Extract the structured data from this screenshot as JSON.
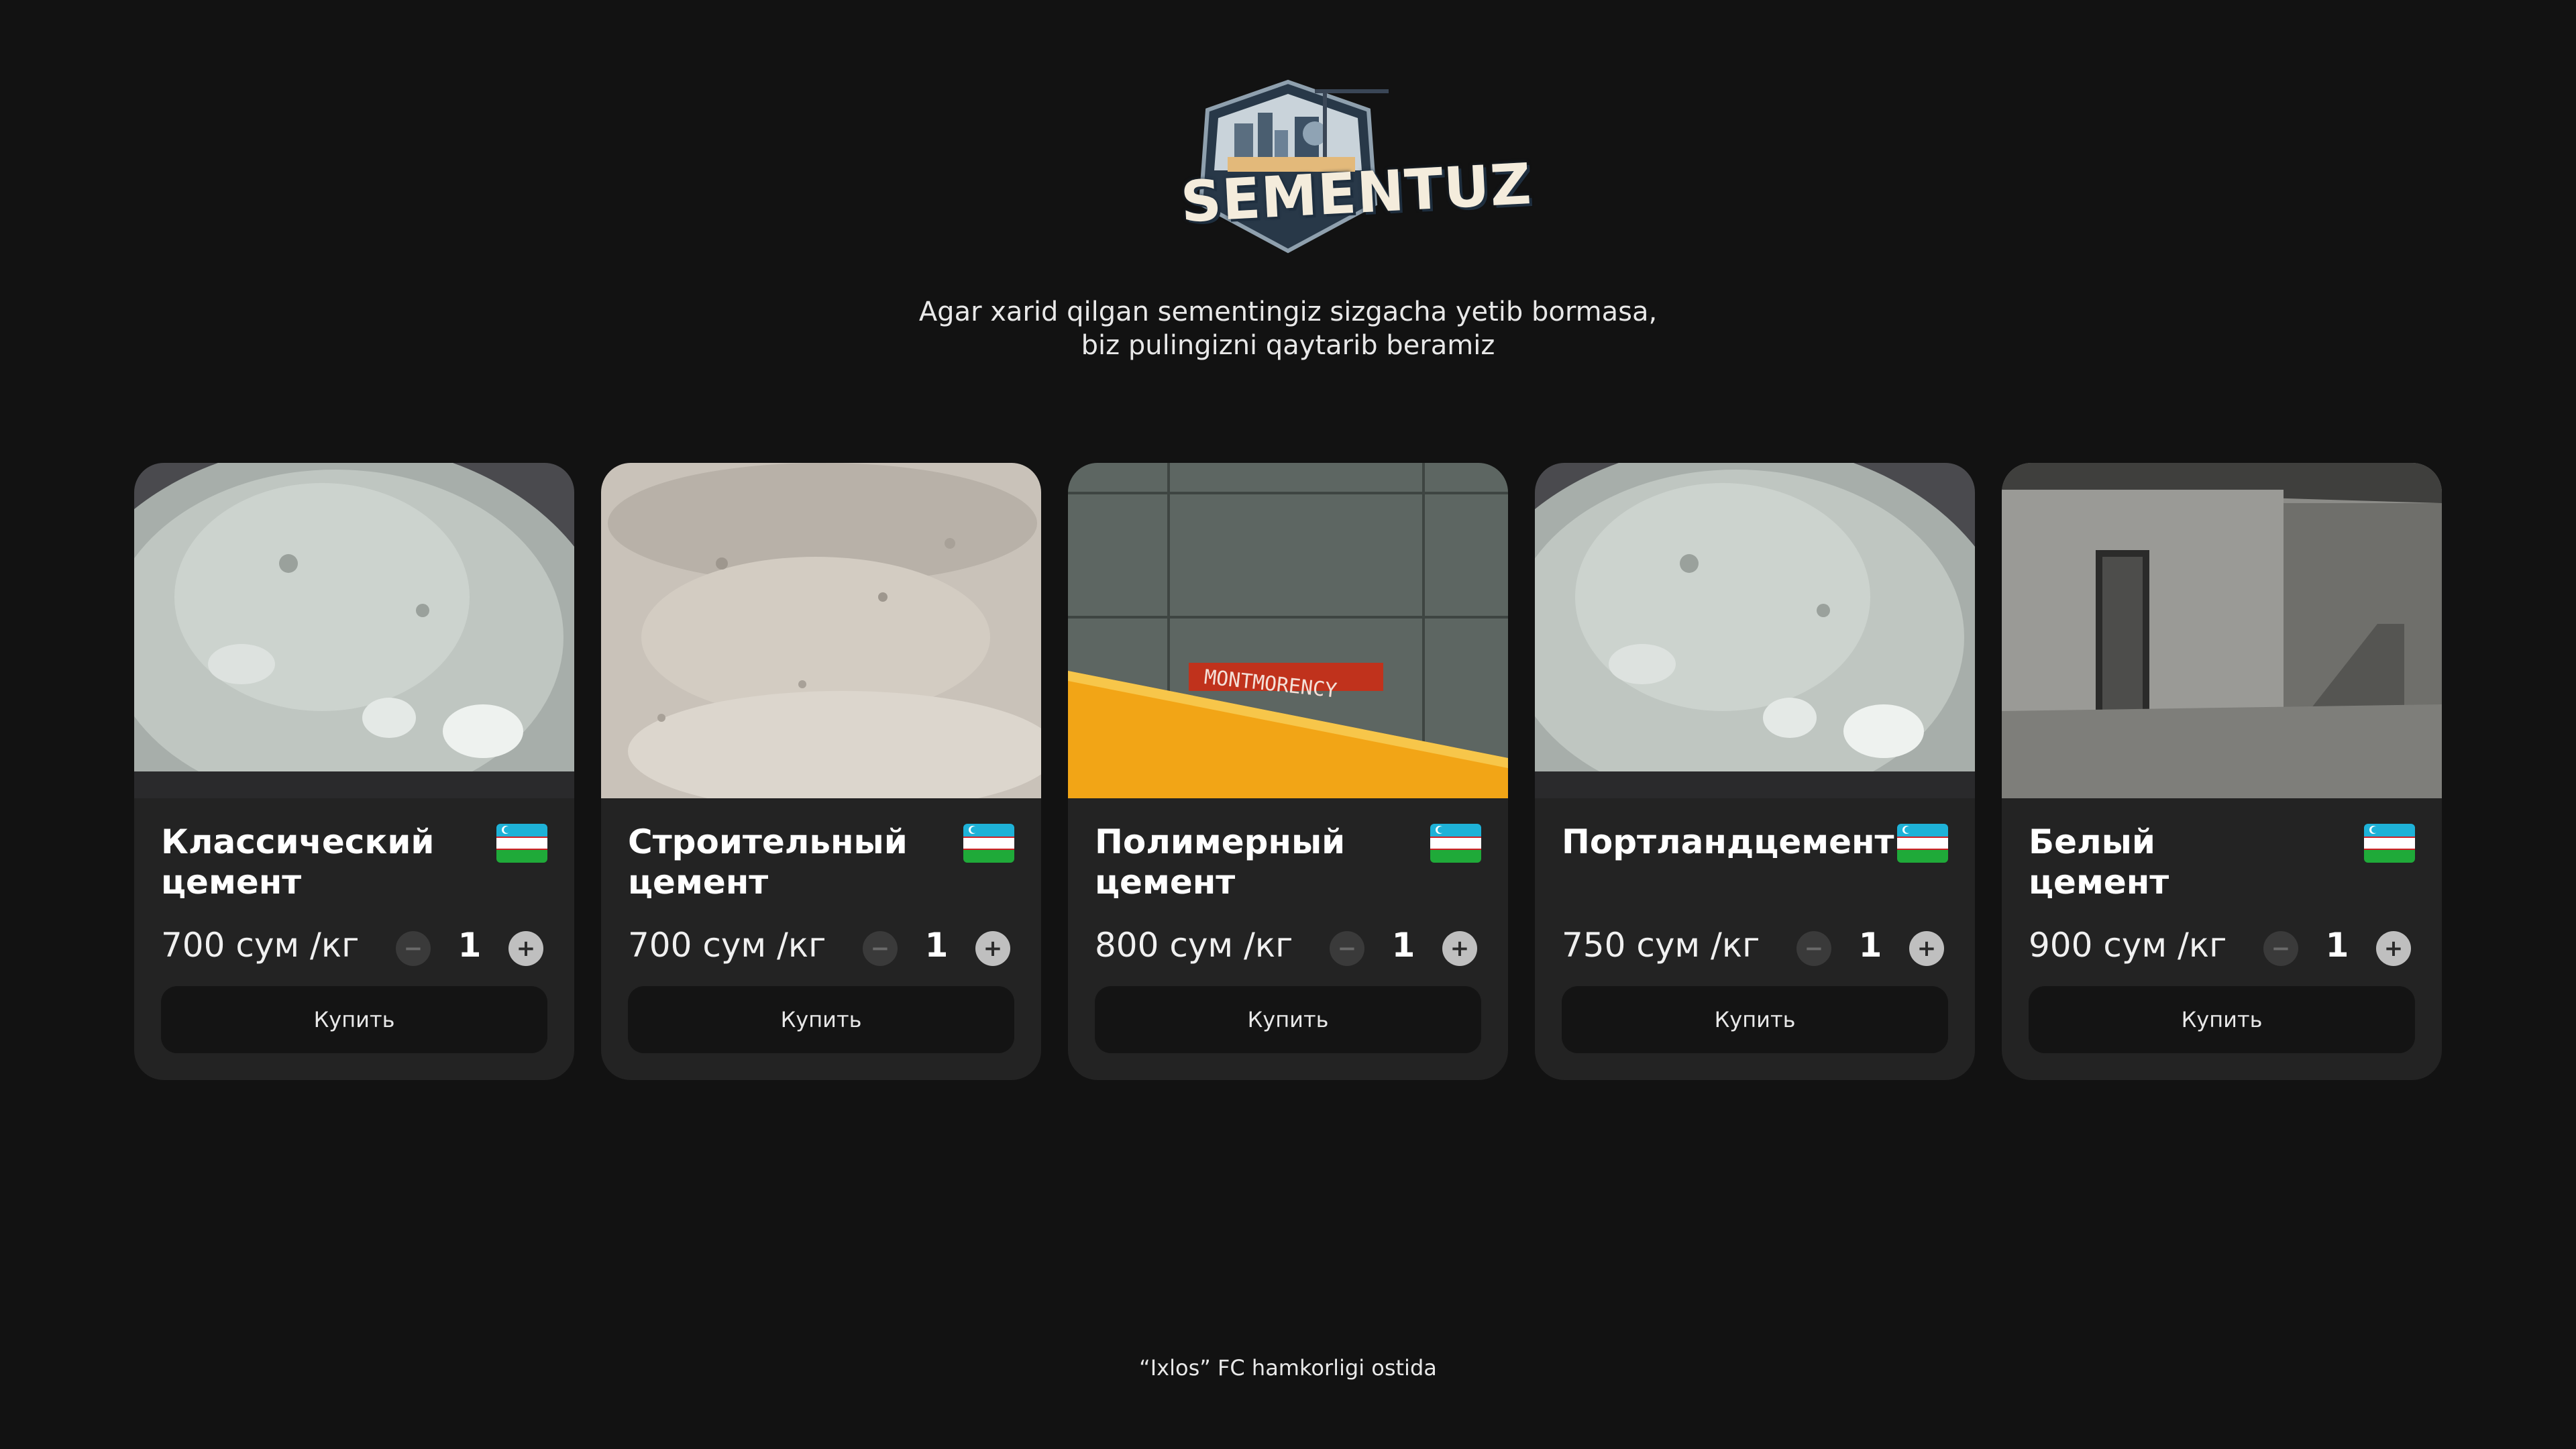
{
  "brand": {
    "name": "SEMENTUZ",
    "accent": "#5a7a90"
  },
  "tagline": {
    "line1": "Agar xarid qilgan sementingiz sizgacha yetib bormasa,",
    "line2": "biz pulingizni qaytarib beramiz"
  },
  "products": [
    {
      "title_line1": "Классический",
      "title_line2": "цемент",
      "price": "700 сум /кг",
      "qty": "1",
      "buy": "Купить",
      "image": "cement-powder-photo",
      "flag": "uzbekistan-flag-icon"
    },
    {
      "title_line1": "Строительный",
      "title_line2": "цемент",
      "price": "700 сум /кг",
      "qty": "1",
      "buy": "Купить",
      "image": "sandy-cement-photo",
      "flag": "uzbekistan-flag-icon"
    },
    {
      "title_line1": "Полимерный",
      "title_line2": "цемент",
      "price": "800 сум /кг",
      "qty": "1",
      "buy": "Купить",
      "image": "concrete-wall-photo",
      "sign_text": "MONTMORENCY",
      "flag": "uzbekistan-flag-icon"
    },
    {
      "title_line1": "Портландцемент",
      "title_line2": "",
      "price": "750 сум /кг",
      "qty": "1",
      "buy": "Купить",
      "image": "cement-powder-photo",
      "flag": "uzbekistan-flag-icon"
    },
    {
      "title_line1": "Белый",
      "title_line2": "цемент",
      "price": "900 сум /кг",
      "qty": "1",
      "buy": "Купить",
      "image": "concrete-interior-photo",
      "flag": "uzbekistan-flag-icon"
    }
  ],
  "controls": {
    "minus_symbol": "−",
    "plus_symbol": "+"
  },
  "footer": {
    "text": "“Ixlos” FC hamkorligi ostida"
  },
  "colors": {
    "background": "#121212",
    "card": "#232323",
    "button": "#141414",
    "flag_blue": "#1eb2d8",
    "flag_green": "#1faa39"
  }
}
